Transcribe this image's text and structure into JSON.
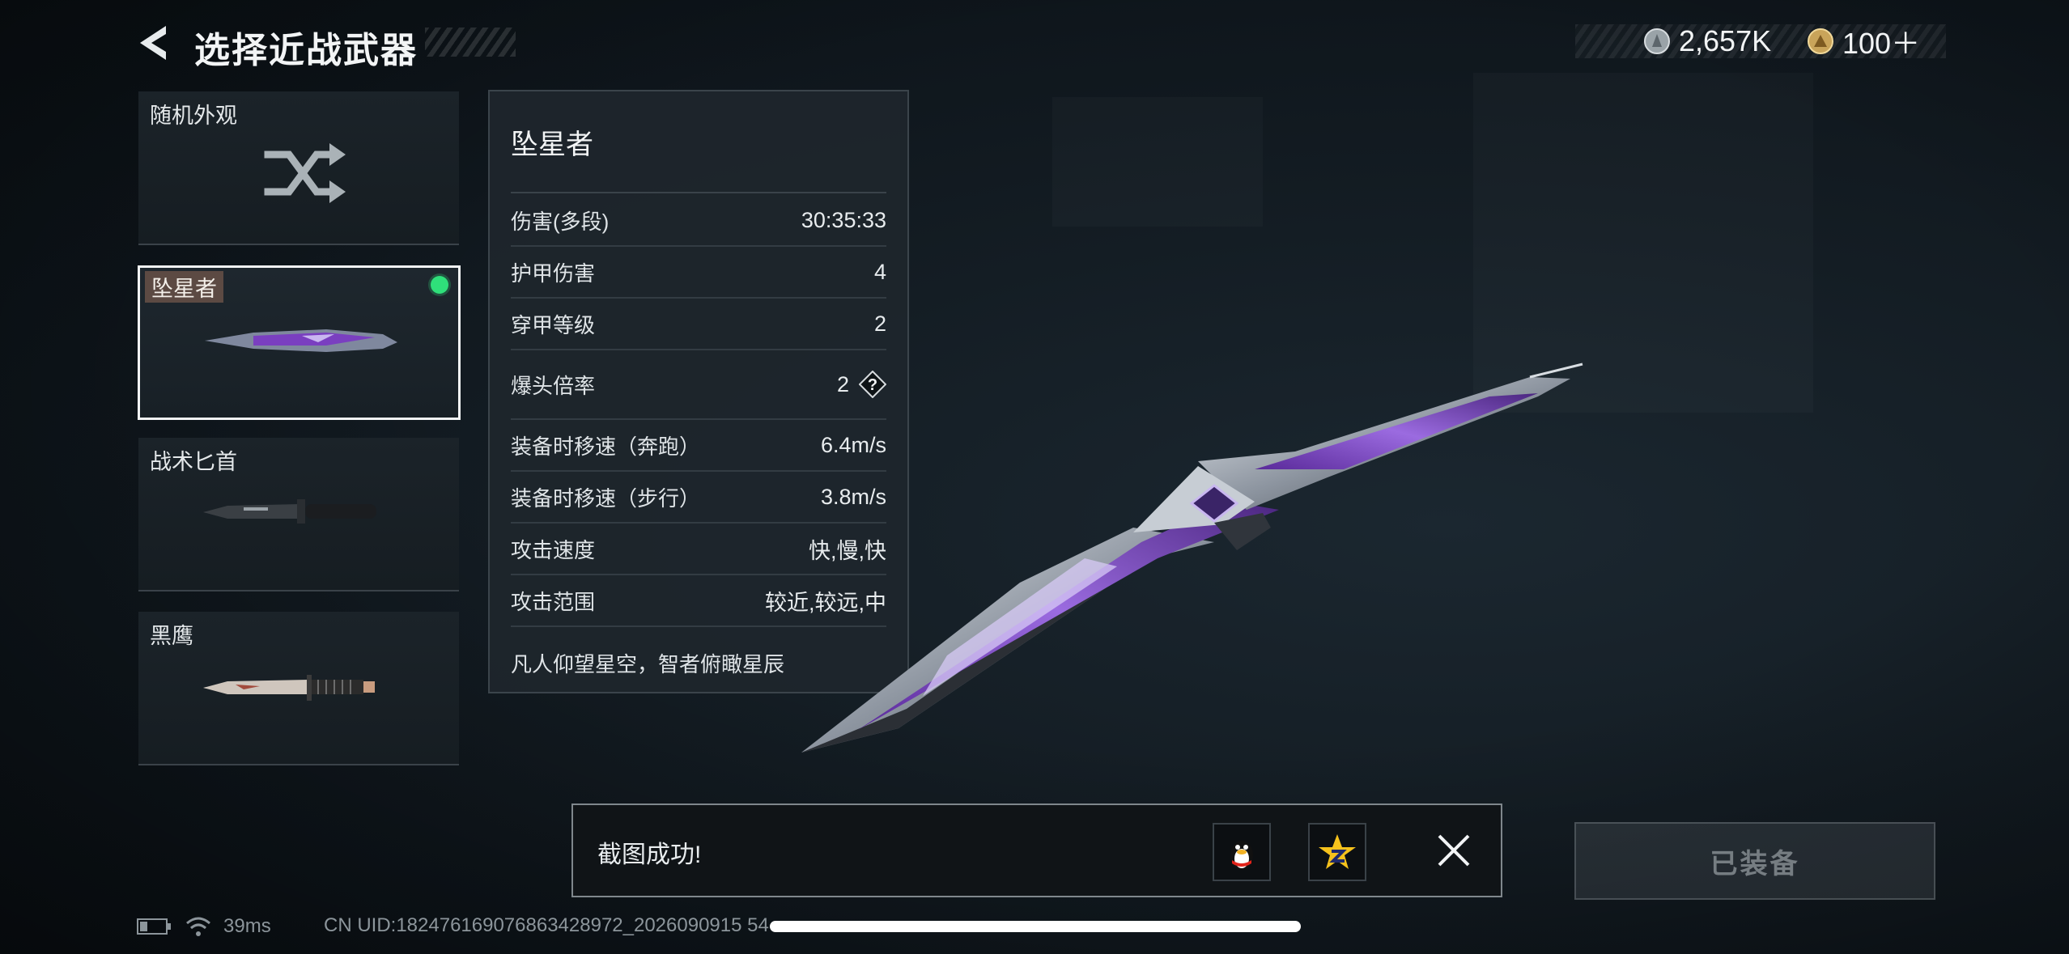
{
  "header": {
    "title": "选择近战武器",
    "currency_silver": "2,657K",
    "currency_gold": "100＋"
  },
  "weapon_list": [
    {
      "label": "随机外观",
      "type": "random",
      "selected": false
    },
    {
      "label": "坠星者",
      "type": "blade",
      "selected": true,
      "equipped": true
    },
    {
      "label": "战术匕首",
      "type": "knife",
      "selected": false
    },
    {
      "label": "黑鹰",
      "type": "hawk",
      "selected": false
    }
  ],
  "stats": {
    "name": "坠星者",
    "rows": [
      {
        "label": "伤害(多段)",
        "value": "30:35:33"
      },
      {
        "label": "护甲伤害",
        "value": "4"
      },
      {
        "label": "穿甲等级",
        "value": "2"
      },
      {
        "label": "爆头倍率",
        "value": "2",
        "help": "?"
      },
      {
        "label": "装备时移速（奔跑）",
        "value": "6.4m/s"
      },
      {
        "label": "装备时移速（步行）",
        "value": "3.8m/s"
      },
      {
        "label": "攻击速度",
        "value": "快,慢,快"
      },
      {
        "label": "攻击范围",
        "value": "较近,较远,中"
      }
    ],
    "description": "凡人仰望星空，智者俯瞰星辰"
  },
  "toast": {
    "message": "截图成功!"
  },
  "equipped_button": "已装备",
  "footer": {
    "ping": "39ms",
    "uid": "CN UID:182476169076863428972_2026090915 54"
  },
  "colors": {
    "equipped_dot": "#2fe07a",
    "selected_border": "#f2f4f5",
    "blade_purple": "#7a3fc0"
  }
}
